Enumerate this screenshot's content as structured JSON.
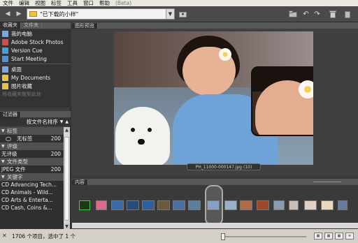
{
  "menu": {
    "items": [
      "文件",
      "编辑",
      "视图",
      "标签",
      "工具",
      "窗口",
      "帮助",
      "(Beta)"
    ]
  },
  "toolbar": {
    "path": "\"已下载的小样\""
  },
  "left_panel": {
    "tabs": [
      "收藏夹",
      "文件夹"
    ],
    "favorites": [
      {
        "label": "我的电脑",
        "icon": "computer-icon",
        "color": "#7aa7e0"
      },
      {
        "label": "Adobe Stock Photos",
        "icon": "stock-photos-icon",
        "color": "#c95050"
      },
      {
        "label": "Version Cue",
        "icon": "version-cue-icon",
        "color": "#4aa0c8"
      },
      {
        "label": "Start Meeting",
        "icon": "meeting-icon",
        "color": "#5a8fd0"
      },
      {
        "label": "桌面",
        "icon": "desktop-icon",
        "color": "#7aa7e0"
      },
      {
        "label": "My Documents",
        "icon": "documents-folder-icon",
        "color": "#e7c24a"
      },
      {
        "label": "图片收藏",
        "icon": "pictures-folder-icon",
        "color": "#e7c24a"
      }
    ],
    "fav_hint": "将收藏夹拖到此处",
    "filter_tab": "过滤器",
    "sort_label": "按文件名排序",
    "filters": [
      {
        "label": "标签",
        "count": "",
        "type": "cat"
      },
      {
        "label": "无标签",
        "count": "200",
        "type": "item"
      },
      {
        "label": "评级",
        "count": "",
        "type": "cat"
      },
      {
        "label": "无评级",
        "count": "200",
        "type": "item"
      },
      {
        "label": "文件类型",
        "count": "",
        "type": "cat"
      },
      {
        "label": "JPEG 文件",
        "count": "200",
        "type": "item"
      },
      {
        "label": "关键字",
        "count": "",
        "type": "cat"
      },
      {
        "label": "CD Advancing Tech...",
        "count": "",
        "type": "item"
      },
      {
        "label": "CD Animals - Wild...",
        "count": "",
        "type": "item"
      },
      {
        "label": "CD Arts & Enterta...",
        "count": "",
        "type": "item"
      },
      {
        "label": "CD Cash, Coins &...",
        "count": "",
        "type": "item"
      }
    ]
  },
  "preview": {
    "tab": "图形预览",
    "caption": "PH_11000-000147.jpg (10)"
  },
  "content": {
    "tab": "内容"
  },
  "status": {
    "text": "1706 个项目，选中了 1 个"
  }
}
